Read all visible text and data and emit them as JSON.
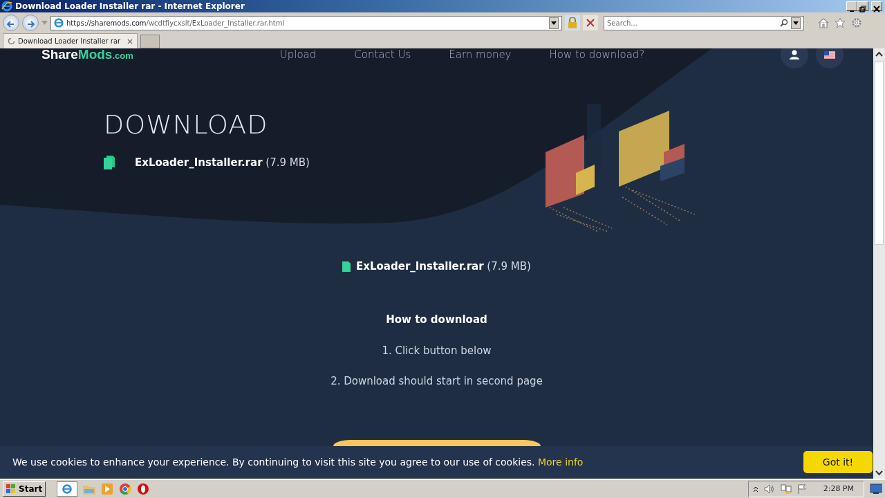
{
  "window": {
    "title": "Download Loader Installer rar - Internet Explorer"
  },
  "address_bar": {
    "host": "https://sharemods.com",
    "path": "/wcdtfiycxsit/ExLoader_Installer.rar.html"
  },
  "search": {
    "placeholder": "Search..."
  },
  "tabs": [
    {
      "label": "Download Loader Installer rar",
      "selected": true
    }
  ],
  "site": {
    "logo": [
      "Share",
      "Mods",
      ".com"
    ],
    "nav": [
      "Upload",
      "Contact Us",
      "Earn money",
      "How to download?"
    ],
    "hero_title": "DOWNLOAD",
    "hero_file": "**ExLoader_Installer.rar** (7.9 MB)",
    "file": "**ExLoader_Installer.rar** (7.9 MB)",
    "how_to_title": "How to download",
    "steps": [
      "1. Click button below",
      "2. Download should start in second page"
    ]
  },
  "cookie_bar": {
    "text": "We use cookies to enhance your experience. By continuing to visit this site you agree to our use of cookies.",
    "link": "More info",
    "button": "Got it!"
  },
  "taskbar": {
    "start": "Start",
    "clock": "2:28 PM"
  }
}
